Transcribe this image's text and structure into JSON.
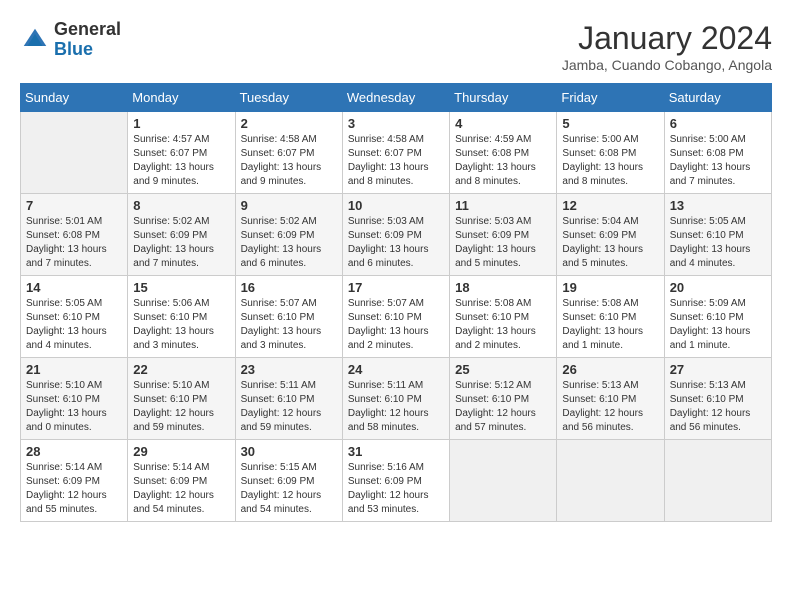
{
  "header": {
    "logo_general": "General",
    "logo_blue": "Blue",
    "month_title": "January 2024",
    "location": "Jamba, Cuando Cobango, Angola"
  },
  "days_of_week": [
    "Sunday",
    "Monday",
    "Tuesday",
    "Wednesday",
    "Thursday",
    "Friday",
    "Saturday"
  ],
  "weeks": [
    [
      {
        "day": "",
        "empty": true
      },
      {
        "day": "1",
        "sunrise": "Sunrise: 4:57 AM",
        "sunset": "Sunset: 6:07 PM",
        "daylight": "Daylight: 13 hours and 9 minutes."
      },
      {
        "day": "2",
        "sunrise": "Sunrise: 4:58 AM",
        "sunset": "Sunset: 6:07 PM",
        "daylight": "Daylight: 13 hours and 9 minutes."
      },
      {
        "day": "3",
        "sunrise": "Sunrise: 4:58 AM",
        "sunset": "Sunset: 6:07 PM",
        "daylight": "Daylight: 13 hours and 8 minutes."
      },
      {
        "day": "4",
        "sunrise": "Sunrise: 4:59 AM",
        "sunset": "Sunset: 6:08 PM",
        "daylight": "Daylight: 13 hours and 8 minutes."
      },
      {
        "day": "5",
        "sunrise": "Sunrise: 5:00 AM",
        "sunset": "Sunset: 6:08 PM",
        "daylight": "Daylight: 13 hours and 8 minutes."
      },
      {
        "day": "6",
        "sunrise": "Sunrise: 5:00 AM",
        "sunset": "Sunset: 6:08 PM",
        "daylight": "Daylight: 13 hours and 7 minutes."
      }
    ],
    [
      {
        "day": "7",
        "sunrise": "Sunrise: 5:01 AM",
        "sunset": "Sunset: 6:08 PM",
        "daylight": "Daylight: 13 hours and 7 minutes."
      },
      {
        "day": "8",
        "sunrise": "Sunrise: 5:02 AM",
        "sunset": "Sunset: 6:09 PM",
        "daylight": "Daylight: 13 hours and 7 minutes."
      },
      {
        "day": "9",
        "sunrise": "Sunrise: 5:02 AM",
        "sunset": "Sunset: 6:09 PM",
        "daylight": "Daylight: 13 hours and 6 minutes."
      },
      {
        "day": "10",
        "sunrise": "Sunrise: 5:03 AM",
        "sunset": "Sunset: 6:09 PM",
        "daylight": "Daylight: 13 hours and 6 minutes."
      },
      {
        "day": "11",
        "sunrise": "Sunrise: 5:03 AM",
        "sunset": "Sunset: 6:09 PM",
        "daylight": "Daylight: 13 hours and 5 minutes."
      },
      {
        "day": "12",
        "sunrise": "Sunrise: 5:04 AM",
        "sunset": "Sunset: 6:09 PM",
        "daylight": "Daylight: 13 hours and 5 minutes."
      },
      {
        "day": "13",
        "sunrise": "Sunrise: 5:05 AM",
        "sunset": "Sunset: 6:10 PM",
        "daylight": "Daylight: 13 hours and 4 minutes."
      }
    ],
    [
      {
        "day": "14",
        "sunrise": "Sunrise: 5:05 AM",
        "sunset": "Sunset: 6:10 PM",
        "daylight": "Daylight: 13 hours and 4 minutes."
      },
      {
        "day": "15",
        "sunrise": "Sunrise: 5:06 AM",
        "sunset": "Sunset: 6:10 PM",
        "daylight": "Daylight: 13 hours and 3 minutes."
      },
      {
        "day": "16",
        "sunrise": "Sunrise: 5:07 AM",
        "sunset": "Sunset: 6:10 PM",
        "daylight": "Daylight: 13 hours and 3 minutes."
      },
      {
        "day": "17",
        "sunrise": "Sunrise: 5:07 AM",
        "sunset": "Sunset: 6:10 PM",
        "daylight": "Daylight: 13 hours and 2 minutes."
      },
      {
        "day": "18",
        "sunrise": "Sunrise: 5:08 AM",
        "sunset": "Sunset: 6:10 PM",
        "daylight": "Daylight: 13 hours and 2 minutes."
      },
      {
        "day": "19",
        "sunrise": "Sunrise: 5:08 AM",
        "sunset": "Sunset: 6:10 PM",
        "daylight": "Daylight: 13 hours and 1 minute."
      },
      {
        "day": "20",
        "sunrise": "Sunrise: 5:09 AM",
        "sunset": "Sunset: 6:10 PM",
        "daylight": "Daylight: 13 hours and 1 minute."
      }
    ],
    [
      {
        "day": "21",
        "sunrise": "Sunrise: 5:10 AM",
        "sunset": "Sunset: 6:10 PM",
        "daylight": "Daylight: 13 hours and 0 minutes."
      },
      {
        "day": "22",
        "sunrise": "Sunrise: 5:10 AM",
        "sunset": "Sunset: 6:10 PM",
        "daylight": "Daylight: 12 hours and 59 minutes."
      },
      {
        "day": "23",
        "sunrise": "Sunrise: 5:11 AM",
        "sunset": "Sunset: 6:10 PM",
        "daylight": "Daylight: 12 hours and 59 minutes."
      },
      {
        "day": "24",
        "sunrise": "Sunrise: 5:11 AM",
        "sunset": "Sunset: 6:10 PM",
        "daylight": "Daylight: 12 hours and 58 minutes."
      },
      {
        "day": "25",
        "sunrise": "Sunrise: 5:12 AM",
        "sunset": "Sunset: 6:10 PM",
        "daylight": "Daylight: 12 hours and 57 minutes."
      },
      {
        "day": "26",
        "sunrise": "Sunrise: 5:13 AM",
        "sunset": "Sunset: 6:10 PM",
        "daylight": "Daylight: 12 hours and 56 minutes."
      },
      {
        "day": "27",
        "sunrise": "Sunrise: 5:13 AM",
        "sunset": "Sunset: 6:10 PM",
        "daylight": "Daylight: 12 hours and 56 minutes."
      }
    ],
    [
      {
        "day": "28",
        "sunrise": "Sunrise: 5:14 AM",
        "sunset": "Sunset: 6:09 PM",
        "daylight": "Daylight: 12 hours and 55 minutes."
      },
      {
        "day": "29",
        "sunrise": "Sunrise: 5:14 AM",
        "sunset": "Sunset: 6:09 PM",
        "daylight": "Daylight: 12 hours and 54 minutes."
      },
      {
        "day": "30",
        "sunrise": "Sunrise: 5:15 AM",
        "sunset": "Sunset: 6:09 PM",
        "daylight": "Daylight: 12 hours and 54 minutes."
      },
      {
        "day": "31",
        "sunrise": "Sunrise: 5:16 AM",
        "sunset": "Sunset: 6:09 PM",
        "daylight": "Daylight: 12 hours and 53 minutes."
      },
      {
        "day": "",
        "empty": true
      },
      {
        "day": "",
        "empty": true
      },
      {
        "day": "",
        "empty": true
      }
    ]
  ]
}
